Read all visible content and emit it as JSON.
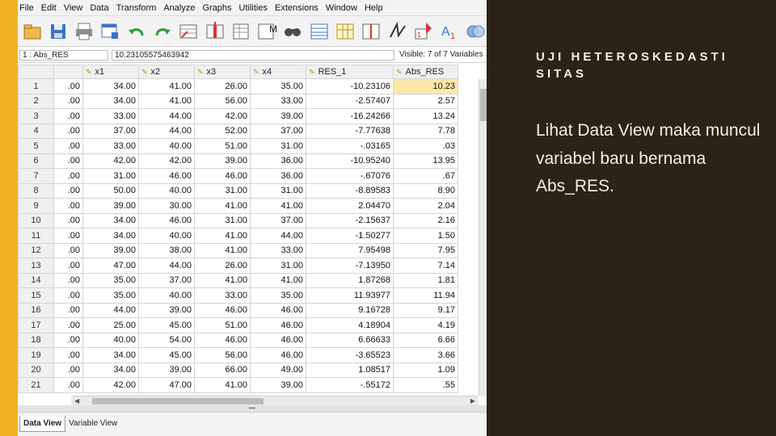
{
  "colors": {
    "accent": "#f0b323",
    "panel_bg": "#2b2318",
    "panel_text": "#f4efe4",
    "highlight_cell": "#fbe7a9"
  },
  "spss": {
    "menu": [
      "File",
      "Edit",
      "View",
      "Data",
      "Transform",
      "Analyze",
      "Graphs",
      "Utilities",
      "Extensions",
      "Window",
      "Help"
    ],
    "toolbar_icons": [
      "open-folder-icon",
      "save-icon",
      "print-icon",
      "dialog-recall-icon",
      "undo-icon",
      "redo-icon",
      "goto-case-icon",
      "goto-variable-icon",
      "variables-icon",
      "run-descriptive-icon",
      "find-icon",
      "insert-cases-icon",
      "insert-variable-icon",
      "split-file-icon",
      "weight-cases-icon",
      "select-cases-icon",
      "value-labels-icon",
      "use-sets-icon"
    ],
    "cellbar": {
      "ref": "1 : Abs_RES",
      "value": "10.23105575463942",
      "visible": "Visible: 7 of 7 Variables"
    },
    "columns": [
      "",
      "x1",
      "x2",
      "x3",
      "x4",
      "RES_1",
      "Abs_RES"
    ],
    "rows": [
      {
        "n": "1",
        "y": ".00",
        "x1": "34.00",
        "x2": "41.00",
        "x3": "26.00",
        "x4": "35.00",
        "res": "-10.23106",
        "abs": "10.23"
      },
      {
        "n": "2",
        "y": ".00",
        "x1": "34.00",
        "x2": "41.00",
        "x3": "56.00",
        "x4": "33.00",
        "res": "-2.57407",
        "abs": "2.57"
      },
      {
        "n": "3",
        "y": ".00",
        "x1": "33.00",
        "x2": "44.00",
        "x3": "42.00",
        "x4": "39.00",
        "res": "-16.24266",
        "abs": "13.24"
      },
      {
        "n": "4",
        "y": ".00",
        "x1": "37.00",
        "x2": "44.00",
        "x3": "52.00",
        "x4": "37.00",
        "res": "-7.77638",
        "abs": "7.78"
      },
      {
        "n": "5",
        "y": ".00",
        "x1": "33.00",
        "x2": "40.00",
        "x3": "51.00",
        "x4": "31.00",
        "res": "-.03165",
        "abs": ".03"
      },
      {
        "n": "6",
        "y": ".00",
        "x1": "42.00",
        "x2": "42.00",
        "x3": "39.00",
        "x4": "36.00",
        "res": "-10.95240",
        "abs": "13.95"
      },
      {
        "n": "7",
        "y": ".00",
        "x1": "31.00",
        "x2": "46.00",
        "x3": "46.00",
        "x4": "36.00",
        "res": "-.67076",
        "abs": ".67"
      },
      {
        "n": "8",
        "y": ".00",
        "x1": "50.00",
        "x2": "40.00",
        "x3": "31.00",
        "x4": "31.00",
        "res": "-8.89583",
        "abs": "8.90"
      },
      {
        "n": "9",
        "y": ".00",
        "x1": "39.00",
        "x2": "30.00",
        "x3": "41.00",
        "x4": "41.00",
        "res": "2.04470",
        "abs": "2.04"
      },
      {
        "n": "10",
        "y": ".00",
        "x1": "34.00",
        "x2": "46.00",
        "x3": "31.00",
        "x4": "37.00",
        "res": "-2.15637",
        "abs": "2.16"
      },
      {
        "n": "11",
        "y": ".00",
        "x1": "34.00",
        "x2": "40.00",
        "x3": "41.00",
        "x4": "44.00",
        "res": "-1.50277",
        "abs": "1.50"
      },
      {
        "n": "12",
        "y": ".00",
        "x1": "39.00",
        "x2": "38.00",
        "x3": "41.00",
        "x4": "33.00",
        "res": "7.95498",
        "abs": "7.95"
      },
      {
        "n": "13",
        "y": ".00",
        "x1": "47.00",
        "x2": "44.00",
        "x3": "26.00",
        "x4": "31.00",
        "res": "-7.13950",
        "abs": "7.14"
      },
      {
        "n": "14",
        "y": ".00",
        "x1": "35.00",
        "x2": "37.00",
        "x3": "41.00",
        "x4": "41.00",
        "res": "1.87268",
        "abs": "1.81"
      },
      {
        "n": "15",
        "y": ".00",
        "x1": "35.00",
        "x2": "40.00",
        "x3": "33.00",
        "x4": "35.00",
        "res": "11.93977",
        "abs": "11.94"
      },
      {
        "n": "16",
        "y": ".00",
        "x1": "44.00",
        "x2": "39.00",
        "x3": "46.00",
        "x4": "46.00",
        "res": "9.16728",
        "abs": "9.17"
      },
      {
        "n": "17",
        "y": ".00",
        "x1": "25.00",
        "x2": "45.00",
        "x3": "51.00",
        "x4": "46.00",
        "res": "4.18904",
        "abs": "4.19"
      },
      {
        "n": "18",
        "y": ".00",
        "x1": "40.00",
        "x2": "54.00",
        "x3": "46.00",
        "x4": "46.00",
        "res": "6.66633",
        "abs": "6.66"
      },
      {
        "n": "19",
        "y": ".00",
        "x1": "34.00",
        "x2": "45.00",
        "x3": "56.00",
        "x4": "46.00",
        "res": "-3.65523",
        "abs": "3.66"
      },
      {
        "n": "20",
        "y": ".00",
        "x1": "34.00",
        "x2": "39.00",
        "x3": "66.00",
        "x4": "49.00",
        "res": "1.08517",
        "abs": "1.09"
      },
      {
        "n": "21",
        "y": ".00",
        "x1": "42.00",
        "x2": "47.00",
        "x3": "41.00",
        "x4": "39.00",
        "res": "-.55172",
        "abs": ".55"
      }
    ],
    "tabs": [
      "Data View",
      "Variable View"
    ]
  },
  "slide": {
    "heading": "UJI HETEROSKEDASTI SITAS",
    "body": "Lihat Data View maka muncul variabel baru bernama Abs_RES."
  }
}
